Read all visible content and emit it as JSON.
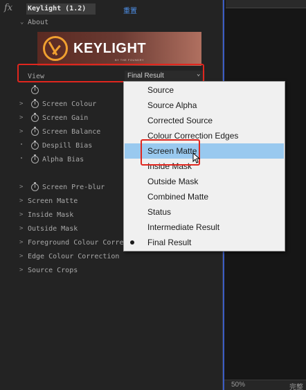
{
  "header": {
    "fx_symbol": "fx",
    "effect_title": "Keylight (1.2)",
    "reset_label": "重置"
  },
  "about": {
    "label": "About"
  },
  "logo": {
    "text": "KEYLIGHT",
    "sub": "BY THE FOUNDRY"
  },
  "view": {
    "label": "View",
    "value": "Final Result"
  },
  "params": [
    {
      "label": "Screen Colour",
      "chev": ">"
    },
    {
      "label": "Screen Gain",
      "chev": ">"
    },
    {
      "label": "Screen Balance",
      "chev": ">"
    },
    {
      "label": "Despill Bias",
      "chev": ""
    },
    {
      "label": "Alpha Bias",
      "chev": ""
    },
    {
      "label": "Screen Pre-blur",
      "chev": ">"
    },
    {
      "label": "Screen Matte",
      "chev": ">"
    },
    {
      "label": "Inside Mask",
      "chev": ">"
    },
    {
      "label": "Outside Mask",
      "chev": ">"
    },
    {
      "label": "Foreground Colour Corre",
      "chev": ">"
    },
    {
      "label": "Edge Colour Correction",
      "chev": ">"
    },
    {
      "label": "Source Crops",
      "chev": ">"
    }
  ],
  "dropdown_menu": {
    "items": [
      "Source",
      "Source Alpha",
      "Corrected Source",
      "Colour Correction Edges",
      "Screen Matte",
      "Inside Mask",
      "Outside Mask",
      "Combined Matte",
      "Status",
      "Intermediate Result",
      "Final Result"
    ],
    "highlighted": "Screen Matte",
    "checked": "Final Result"
  },
  "footer": {
    "zoom": "50%",
    "channel": "完整"
  },
  "colors": {
    "highlight": "#99c9ef",
    "annotation": "#e0261e",
    "reset_link": "#4d8fe8"
  }
}
